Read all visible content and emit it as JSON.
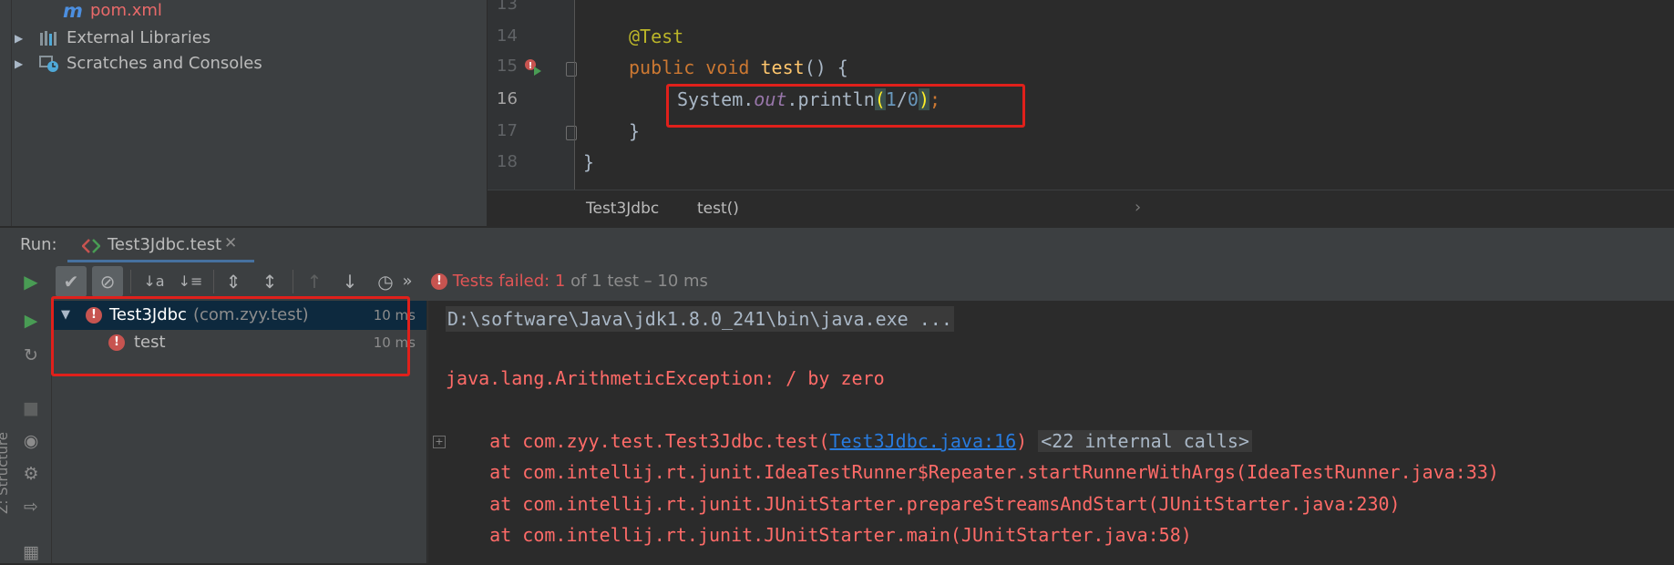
{
  "project_tree": {
    "items": [
      {
        "label": "pom.xml",
        "icon": "maven-file-icon"
      },
      {
        "label": "External Libraries",
        "icon": "libraries-icon"
      },
      {
        "label": "Scratches and Consoles",
        "icon": "scratches-icon"
      }
    ]
  },
  "editor": {
    "line_numbers": [
      "13",
      "14",
      "15",
      "16",
      "17",
      "18"
    ],
    "code": {
      "annotation": "@Test",
      "kw_public": "public",
      "kw_void": "void",
      "method_name": "test",
      "method_rest": "() {",
      "system": "System.",
      "out_field": "out",
      "println": ".println",
      "open_paren": "(",
      "num_one": "1",
      "slash": "/",
      "num_zero": "0",
      "close_paren": ")",
      "semicolon": ";",
      "close_inner": "}",
      "close_outer": "}"
    },
    "breadcrumb": {
      "class_name": "Test3Jdbc",
      "method": "test()"
    }
  },
  "run_window": {
    "label": "Run:",
    "tab_label": "Test3Jdbc.test",
    "status_failed": "Tests failed: 1",
    "status_rest": "of 1 test – 10 ms",
    "toolbar_more": "»"
  },
  "test_tree": {
    "root": {
      "name": "Test3Jdbc",
      "package": "(com.zyy.test)",
      "time": "10 ms"
    },
    "child": {
      "name": "test",
      "time": "10 ms"
    }
  },
  "console": {
    "command": "D:\\software\\Java\\jdk1.8.0_241\\bin\\java.exe ...",
    "exception": "java.lang.ArithmeticException: / by zero",
    "stack": {
      "line1_prefix": "    at com.zyy.test.Test3Jdbc.test(",
      "line1_link": "Test3Jdbc.java:16",
      "line1_suffix": ")",
      "line1_fold": "<22 internal calls>",
      "line2": "    at com.intellij.rt.junit.IdeaTestRunner$Repeater.startRunnerWithArgs(IdeaTestRunner.java:33)",
      "line3": "    at com.intellij.rt.junit.JUnitStarter.prepareStreamsAndStart(JUnitStarter.java:230)",
      "line4": "    at com.intellij.rt.junit.JUnitStarter.main(JUnitStarter.java:58)"
    }
  },
  "side_strip": {
    "structure_label": "Z: Structure"
  },
  "colors": {
    "highlight_box": "#e0201b",
    "error": "#c75450",
    "selection": "#0d293e"
  }
}
